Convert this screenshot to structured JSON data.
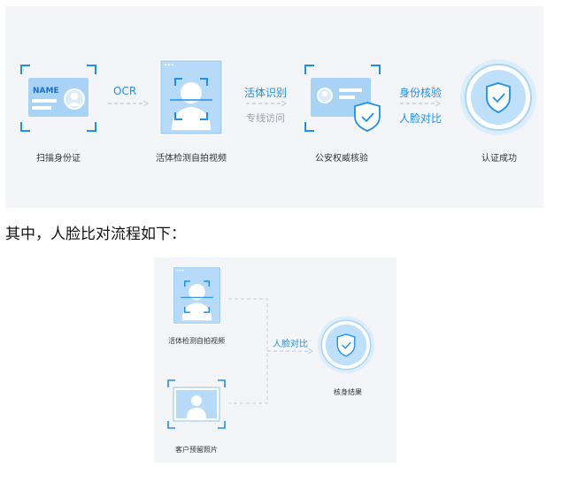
{
  "top_flow": {
    "steps": [
      {
        "label": "扫描身份证",
        "icon": "id-card-scan-icon"
      },
      {
        "label": "活体检测自拍视频",
        "icon": "face-scan-icon"
      },
      {
        "label": "公安权威核验",
        "icon": "id-card-verified-icon"
      },
      {
        "label": "认证成功",
        "icon": "shield-check-icon"
      }
    ],
    "card_text": "NAME",
    "connectors": [
      {
        "top": "OCR",
        "bottom": ""
      },
      {
        "top": "活体识别",
        "bottom": "专线访问"
      },
      {
        "top": "身份核验",
        "bottom": "人脸对比"
      }
    ]
  },
  "sentence": "其中，人脸比对流程如下：",
  "bottom_flow": {
    "inputs": [
      {
        "label": "活体检测自拍视频",
        "icon": "face-scan-icon"
      },
      {
        "label": "客户预留照片",
        "icon": "portrait-photo-icon"
      }
    ],
    "connector": "人脸对比",
    "result": {
      "label": "核身结果",
      "icon": "shield-check-icon"
    }
  },
  "colors": {
    "accent": "#1e8fea",
    "panel": "#f3f5f8",
    "card": "#a9d3f5"
  }
}
